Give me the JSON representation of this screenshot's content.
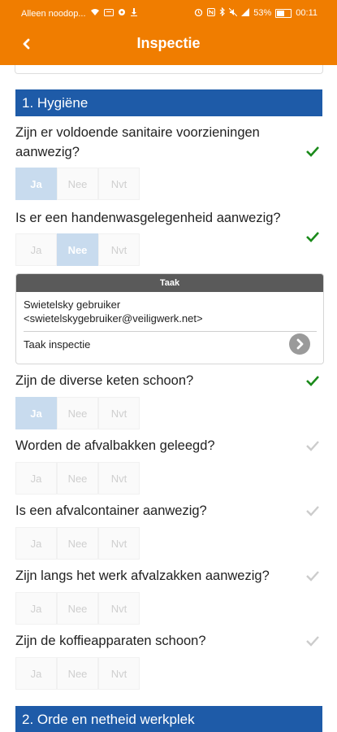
{
  "status": {
    "carrier": "Alleen noodop...",
    "battery": "53%",
    "time": "00:11"
  },
  "header": {
    "title": "Inspectie",
    "back_icon": "chevron-left-icon"
  },
  "sections": [
    {
      "title": "1. Hygiëne"
    },
    {
      "title": "2. Orde en netheid werkplek"
    }
  ],
  "answer_options": [
    "Ja",
    "Nee",
    "Nvt"
  ],
  "questions": [
    {
      "text": "Zijn er voldoende sanitaire voorzieningen aanwezig?",
      "selected": "Ja",
      "answered": true
    },
    {
      "text": "Is er een handenwasgelegenheid aanwezig?",
      "selected": "Nee",
      "answered": true
    },
    {
      "text": "Zijn de diverse keten schoon?",
      "selected": "Ja",
      "answered": true
    },
    {
      "text": "Worden de afvalbakken geleegd?",
      "selected": null,
      "answered": false
    },
    {
      "text": "Is een afvalcontainer aanwezig?",
      "selected": null,
      "answered": false
    },
    {
      "text": "Zijn langs het werk afvalzakken aanwezig?",
      "selected": null,
      "answered": false
    },
    {
      "text": "Zijn de koffieapparaten schoon?",
      "selected": null,
      "answered": false
    }
  ],
  "task": {
    "header": "Taak",
    "user_name": "Swietelsky gebruiker",
    "user_email": "<swietelskygebruiker@veiligwerk.net>",
    "label": "Taak inspectie"
  },
  "colors": {
    "accent": "#f07d00",
    "section": "#1e5ba8",
    "check_done": "#1a8a1a",
    "check_pending": "#cccccc"
  }
}
